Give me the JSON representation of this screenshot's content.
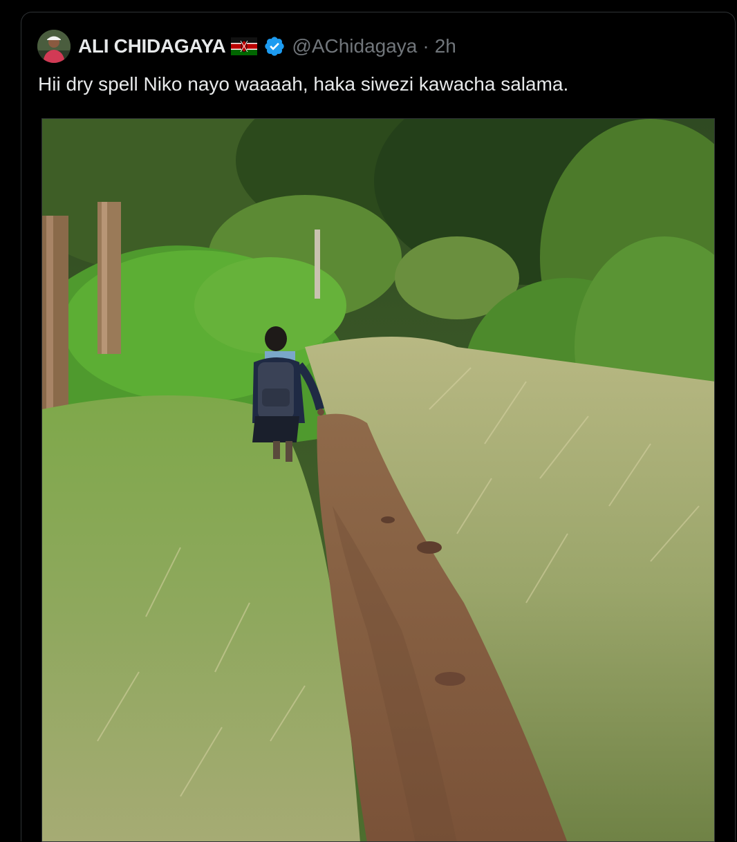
{
  "tweet": {
    "author": {
      "display_name": "ALI CHIDAGAYA",
      "flag_icon": "kenya-flag-icon",
      "verified_icon": "verified-badge-icon",
      "handle": "@AChidagaya",
      "separator": "·",
      "timestamp": "2h"
    },
    "text": "Hii dry spell Niko nayo waaaah, haka siwezi kawacha salama.",
    "media": {
      "type": "photo",
      "alt": ""
    }
  },
  "colors": {
    "background": "#000000",
    "text_primary": "#e7e9ea",
    "text_secondary": "#71767b",
    "border": "#2f3336",
    "verified_blue": "#1d9bf0"
  }
}
